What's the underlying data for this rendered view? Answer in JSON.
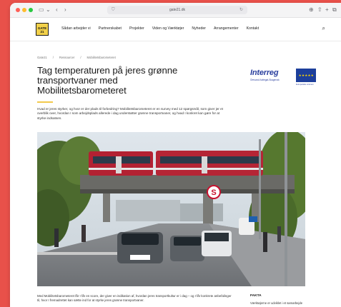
{
  "browser": {
    "url": "gate21.dk"
  },
  "nav": {
    "logo": "GATE 21",
    "links": [
      "Sådan arbejder vi",
      "Partnerskabet",
      "Projekter",
      "Viden og Værktøjer",
      "Nyheder",
      "Arrangementer",
      "Kontakt"
    ]
  },
  "breadcrumb": [
    "Gate21",
    "Ressourcer",
    "Mobilitetsbarometeret"
  ],
  "article": {
    "title": "Tag temperaturen på jeres grønne transportvaner med Mobilitetsbarometeret",
    "intro": "Hvad er jeres styrker, og hvor er der plads til forbedring? Mobilitetsbarometeret er en survey med 12 spørgsmål, som giver jer et overblik over, hvordan I som arbejdsplads allerede i dag understøtter grønne transportvaner, og hvad I konkret kan gøre for at styrke indsatsen.",
    "body": "Med Mobilitetsbarometeret får I får en score, der giver en indikation af, hvordan jeres transportkultur er i dag – og I får konkrete anbefalinger til, hvor I fremadrettet kan sætte ind for at styrke jeres grønne transportvaner."
  },
  "interreg": {
    "name": "Interreg",
    "program": "Öresund-Kattegat-Skagerrak",
    "eu_caption": "Europeiska unionen"
  },
  "fakta": {
    "title": "FAKTA",
    "text": "Værktøjerne er udviklet i et samarbejde"
  },
  "hero": {
    "station_sign": "S"
  }
}
